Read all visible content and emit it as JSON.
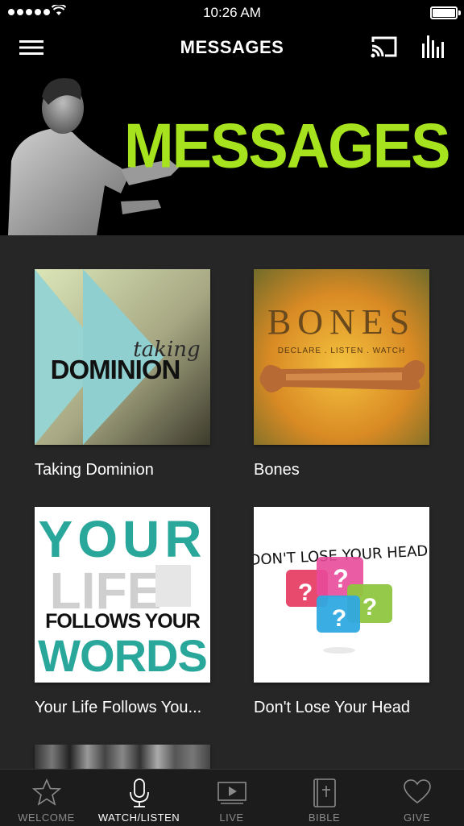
{
  "status_bar": {
    "time": "10:26 AM"
  },
  "navbar": {
    "title": "MESSAGES",
    "menu_icon": "hamburger-icon",
    "cast_icon": "cast-icon",
    "audio_icon": "bars-icon"
  },
  "hero": {
    "heading": "MESSAGES",
    "accent_color": "#a6e21d"
  },
  "series": [
    {
      "title": "Taking Dominion",
      "art_line1": "taking",
      "art_line2": "DOMINION"
    },
    {
      "title": "Bones",
      "art_line1": "BONES",
      "art_line2": "DECLARE . LISTEN . WATCH"
    },
    {
      "title": "Your Life Follows You...",
      "art_line1": "YOUR",
      "art_line2": "LIFE",
      "art_line3": "FOLLOWS YOUR",
      "art_line4": "WORDS"
    },
    {
      "title": "Don't Lose Your Head",
      "art_line1": "DON'T LOSE YOUR HEAD!"
    }
  ],
  "tabs": [
    {
      "label": "WELCOME",
      "icon": "star-icon",
      "active": false
    },
    {
      "label": "WATCH/LISTEN",
      "icon": "microphone-icon",
      "active": true
    },
    {
      "label": "LIVE",
      "icon": "play-screen-icon",
      "active": false
    },
    {
      "label": "BIBLE",
      "icon": "bible-icon",
      "active": false
    },
    {
      "label": "GIVE",
      "icon": "heart-icon",
      "active": false
    }
  ]
}
